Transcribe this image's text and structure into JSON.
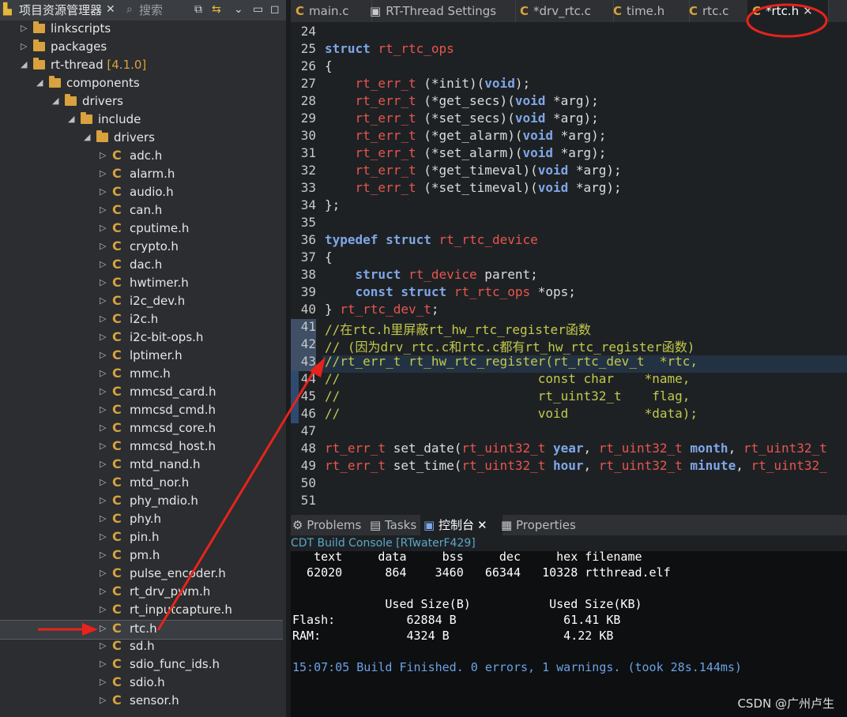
{
  "left_panel": {
    "tab_explorer": "项目资源管理器",
    "tab_search": "搜索",
    "tree": [
      {
        "label": "linkscripts",
        "type": "folder",
        "level": 1,
        "expanded": false
      },
      {
        "label": "packages",
        "type": "folder",
        "level": 1,
        "expanded": false
      },
      {
        "label": "rt-thread",
        "version": "[4.1.0]",
        "type": "folder",
        "level": 1,
        "expanded": true
      },
      {
        "label": "components",
        "type": "folder",
        "level": 2,
        "expanded": true
      },
      {
        "label": "drivers",
        "type": "folder",
        "level": 3,
        "expanded": true
      },
      {
        "label": "include",
        "type": "folder",
        "level": 4,
        "expanded": true
      },
      {
        "label": "drivers",
        "type": "folder",
        "level": 5,
        "expanded": true
      },
      {
        "label": "adc.h",
        "type": "file"
      },
      {
        "label": "alarm.h",
        "type": "file"
      },
      {
        "label": "audio.h",
        "type": "file"
      },
      {
        "label": "can.h",
        "type": "file"
      },
      {
        "label": "cputime.h",
        "type": "file"
      },
      {
        "label": "crypto.h",
        "type": "file"
      },
      {
        "label": "dac.h",
        "type": "file"
      },
      {
        "label": "hwtimer.h",
        "type": "file"
      },
      {
        "label": "i2c_dev.h",
        "type": "file"
      },
      {
        "label": "i2c.h",
        "type": "file"
      },
      {
        "label": "i2c-bit-ops.h",
        "type": "file"
      },
      {
        "label": "lptimer.h",
        "type": "file"
      },
      {
        "label": "mmc.h",
        "type": "file"
      },
      {
        "label": "mmcsd_card.h",
        "type": "file"
      },
      {
        "label": "mmcsd_cmd.h",
        "type": "file"
      },
      {
        "label": "mmcsd_core.h",
        "type": "file"
      },
      {
        "label": "mmcsd_host.h",
        "type": "file"
      },
      {
        "label": "mtd_nand.h",
        "type": "file"
      },
      {
        "label": "mtd_nor.h",
        "type": "file"
      },
      {
        "label": "phy_mdio.h",
        "type": "file"
      },
      {
        "label": "phy.h",
        "type": "file"
      },
      {
        "label": "pin.h",
        "type": "file"
      },
      {
        "label": "pm.h",
        "type": "file"
      },
      {
        "label": "pulse_encoder.h",
        "type": "file"
      },
      {
        "label": "rt_drv_pwm.h",
        "type": "file"
      },
      {
        "label": "rt_inputcapture.h",
        "type": "file"
      },
      {
        "label": "rtc.h",
        "type": "file",
        "selected": true
      },
      {
        "label": "sd.h",
        "type": "file"
      },
      {
        "label": "sdio_func_ids.h",
        "type": "file"
      },
      {
        "label": "sdio.h",
        "type": "file"
      },
      {
        "label": "sensor.h",
        "type": "file"
      }
    ]
  },
  "editor_tabs": [
    {
      "label": "main.c",
      "active": false
    },
    {
      "label": "RT-Thread Settings",
      "active": false
    },
    {
      "label": "*drv_rtc.c",
      "active": false
    },
    {
      "label": "time.h",
      "active": false
    },
    {
      "label": "rtc.c",
      "active": false
    },
    {
      "label": "*rtc.h",
      "active": true
    }
  ],
  "code_lines": [
    {
      "n": "24",
      "segs": []
    },
    {
      "n": "25",
      "segs": [
        [
          "kw",
          "struct"
        ],
        [
          "nm",
          " "
        ],
        [
          "ty",
          "rt_rtc_ops"
        ]
      ]
    },
    {
      "n": "26",
      "segs": [
        [
          "nm",
          "{"
        ]
      ]
    },
    {
      "n": "27",
      "segs": [
        [
          "nm",
          "    "
        ],
        [
          "ty",
          "rt_err_t"
        ],
        [
          "nm",
          " (*init)("
        ],
        [
          "kw",
          "void"
        ],
        [
          "nm",
          ");"
        ]
      ]
    },
    {
      "n": "28",
      "segs": [
        [
          "nm",
          "    "
        ],
        [
          "ty",
          "rt_err_t"
        ],
        [
          "nm",
          " (*get_secs)("
        ],
        [
          "kw",
          "void"
        ],
        [
          "nm",
          " *arg);"
        ]
      ]
    },
    {
      "n": "29",
      "segs": [
        [
          "nm",
          "    "
        ],
        [
          "ty",
          "rt_err_t"
        ],
        [
          "nm",
          " (*set_secs)("
        ],
        [
          "kw",
          "void"
        ],
        [
          "nm",
          " *arg);"
        ]
      ]
    },
    {
      "n": "30",
      "segs": [
        [
          "nm",
          "    "
        ],
        [
          "ty",
          "rt_err_t"
        ],
        [
          "nm",
          " (*get_alarm)("
        ],
        [
          "kw",
          "void"
        ],
        [
          "nm",
          " *arg);"
        ]
      ]
    },
    {
      "n": "31",
      "segs": [
        [
          "nm",
          "    "
        ],
        [
          "ty",
          "rt_err_t"
        ],
        [
          "nm",
          " (*set_alarm)("
        ],
        [
          "kw",
          "void"
        ],
        [
          "nm",
          " *arg);"
        ]
      ]
    },
    {
      "n": "32",
      "segs": [
        [
          "nm",
          "    "
        ],
        [
          "ty",
          "rt_err_t"
        ],
        [
          "nm",
          " (*get_timeval)("
        ],
        [
          "kw",
          "void"
        ],
        [
          "nm",
          " *arg);"
        ]
      ]
    },
    {
      "n": "33",
      "segs": [
        [
          "nm",
          "    "
        ],
        [
          "ty",
          "rt_err_t"
        ],
        [
          "nm",
          " (*set_timeval)("
        ],
        [
          "kw",
          "void"
        ],
        [
          "nm",
          " *arg);"
        ]
      ]
    },
    {
      "n": "34",
      "segs": [
        [
          "nm",
          "};"
        ]
      ]
    },
    {
      "n": "35",
      "segs": []
    },
    {
      "n": "36",
      "segs": [
        [
          "kw",
          "typedef"
        ],
        [
          "nm",
          " "
        ],
        [
          "kw",
          "struct"
        ],
        [
          "nm",
          " "
        ],
        [
          "ty",
          "rt_rtc_device"
        ]
      ]
    },
    {
      "n": "37",
      "segs": [
        [
          "nm",
          "{"
        ]
      ]
    },
    {
      "n": "38",
      "segs": [
        [
          "nm",
          "    "
        ],
        [
          "kw",
          "struct"
        ],
        [
          "nm",
          " "
        ],
        [
          "ty",
          "rt_device"
        ],
        [
          "nm",
          " parent;"
        ]
      ]
    },
    {
      "n": "39",
      "segs": [
        [
          "nm",
          "    "
        ],
        [
          "kw",
          "const"
        ],
        [
          "nm",
          " "
        ],
        [
          "kw",
          "struct"
        ],
        [
          "nm",
          " "
        ],
        [
          "ty",
          "rt_rtc_ops"
        ],
        [
          "nm",
          " *ops;"
        ]
      ]
    },
    {
      "n": "40",
      "segs": [
        [
          "nm",
          "} "
        ],
        [
          "ty",
          "rt_rtc_dev_t"
        ],
        [
          "nm",
          ";"
        ]
      ]
    },
    {
      "n": "41",
      "segs": [
        [
          "cm",
          "//在rtc.h里屏蔽rt_hw_rtc_register函数"
        ]
      ]
    },
    {
      "n": "42",
      "segs": [
        [
          "cm",
          "// (因为drv_rtc.c和rtc.c都有rt_hw_rtc_register函数)"
        ]
      ]
    },
    {
      "n": "43",
      "segs": [
        [
          "cm",
          "//rt_err_t rt_hw_rtc_register(rt_rtc_dev_t  *rtc,"
        ]
      ]
    },
    {
      "n": "44",
      "segs": [
        [
          "cm",
          "//                          const char    *name,"
        ]
      ]
    },
    {
      "n": "45",
      "segs": [
        [
          "cm",
          "//                          rt_uint32_t    flag,"
        ]
      ]
    },
    {
      "n": "46",
      "segs": [
        [
          "cm",
          "//                          void          *data);"
        ]
      ]
    },
    {
      "n": "47",
      "segs": []
    },
    {
      "n": "48",
      "segs": [
        [
          "ty",
          "rt_err_t"
        ],
        [
          "nm",
          " set_date("
        ],
        [
          "ty",
          "rt_uint32_t"
        ],
        [
          "kw",
          " year"
        ],
        [
          "nm",
          ", "
        ],
        [
          "ty",
          "rt_uint32_t"
        ],
        [
          "kw",
          " month"
        ],
        [
          "nm",
          ", "
        ],
        [
          "ty",
          "rt_uint32_t"
        ]
      ]
    },
    {
      "n": "49",
      "segs": [
        [
          "ty",
          "rt_err_t"
        ],
        [
          "nm",
          " set_time("
        ],
        [
          "ty",
          "rt_uint32_t"
        ],
        [
          "kw",
          " hour"
        ],
        [
          "nm",
          ", "
        ],
        [
          "ty",
          "rt_uint32_t"
        ],
        [
          "kw",
          " minute"
        ],
        [
          "nm",
          ", "
        ],
        [
          "ty",
          "rt_uint32_"
        ]
      ]
    },
    {
      "n": "50",
      "segs": []
    },
    {
      "n": "51",
      "segs": []
    }
  ],
  "bottom_tabs": [
    {
      "label": "Problems",
      "active": false
    },
    {
      "label": "Tasks",
      "active": false
    },
    {
      "label": "控制台",
      "active": true
    },
    {
      "label": "Properties",
      "active": false
    }
  ],
  "console": {
    "title": "CDT Build Console [RTwaterF429]",
    "lines": [
      "   text     data     bss     dec     hex filename",
      "  62020      864    3460   66344   10328 rtthread.elf",
      "",
      "             Used Size(B)           Used Size(KB)",
      "Flash:          62884 B               61.41 KB",
      "RAM:            4324 B                4.22 KB",
      "",
      "15:07:05 Build Finished. 0 errors, 1 warnings. (took 28s.144ms)"
    ]
  },
  "watermark": "CSDN @广州卢生",
  "colors": {
    "annotation": "#e8231c",
    "keyword": "#7fa7e8",
    "type": "#e8554e",
    "comment": "#c2c94a"
  }
}
